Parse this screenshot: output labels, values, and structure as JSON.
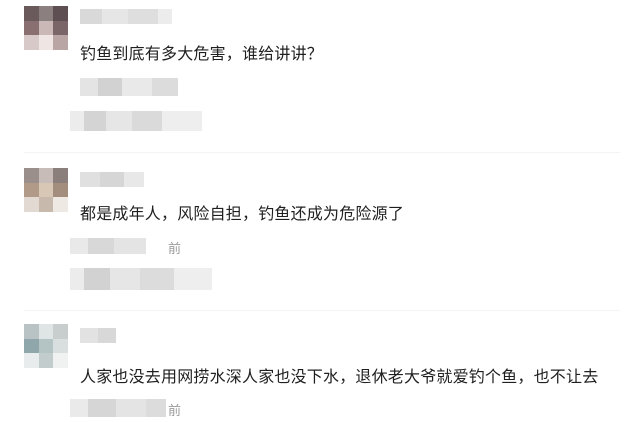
{
  "comments": [
    {
      "text": "钓鱼到底有多大危害，谁给讲讲？",
      "time_suffix": ""
    },
    {
      "text": "都是成年人，风险自担，钓鱼还成为危险源了",
      "time_suffix": "前"
    },
    {
      "text": "人家也没去用网捞水深人家也没下水，退休老大爷就爱钓个鱼，也不让去",
      "time_suffix": "前"
    }
  ]
}
